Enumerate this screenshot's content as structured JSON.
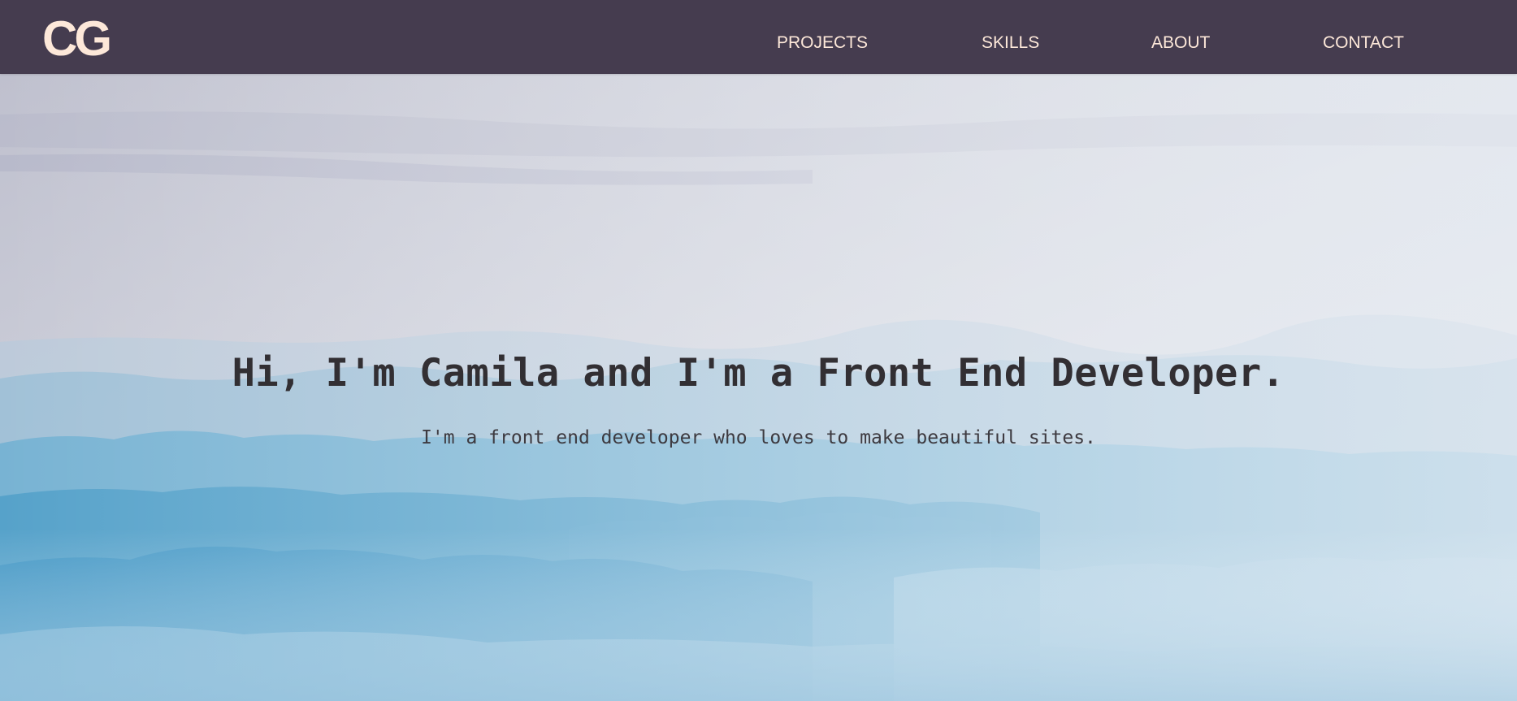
{
  "nav": {
    "logo": "CG",
    "links": [
      {
        "label": "PROJECTS"
      },
      {
        "label": "SKILLS"
      },
      {
        "label": "ABOUT"
      },
      {
        "label": "CONTACT"
      }
    ]
  },
  "hero": {
    "title": "Hi, I'm Camila and I'm a Front End Developer.",
    "subtitle": "I'm a front end developer who loves to make beautiful sites.",
    "background": "misty-blue-mountains-image"
  },
  "colors": {
    "navbar_bg": "#453c4f",
    "nav_text": "#fde8d9",
    "heading_text": "#322f33",
    "sky_top": "#c4c6d3",
    "mountain_blue": "#4ea0c9"
  }
}
